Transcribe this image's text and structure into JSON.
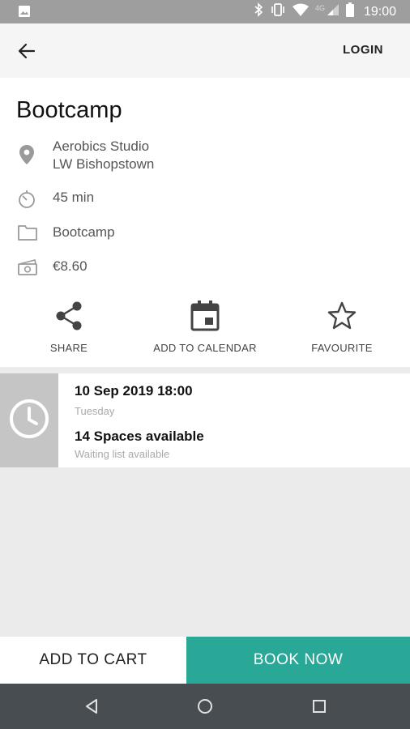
{
  "status_bar": {
    "time": "19:00",
    "network": "4G",
    "icons": [
      "image-icon",
      "bluetooth-icon",
      "vibrate-icon",
      "wifi-icon",
      "signal-icon",
      "battery-icon"
    ]
  },
  "toolbar": {
    "back_icon": "arrow-left-icon",
    "login_label": "LOGIN"
  },
  "class_detail": {
    "title": "Bootcamp",
    "location_line1": "Aerobics Studio",
    "location_line2": "LW Bishopstown",
    "duration": "45 min",
    "category": "Bootcamp",
    "price": "€8.60"
  },
  "actions": {
    "share_label": "SHARE",
    "calendar_label": "ADD TO CALENDAR",
    "favourite_label": "FAVOURITE"
  },
  "session": {
    "date_time": "10 Sep 2019 18:00",
    "day": "Tuesday",
    "spaces": "14 Spaces available",
    "waiting": "Waiting list available"
  },
  "bottom": {
    "add_to_cart": "ADD TO CART",
    "book_now": "BOOK NOW"
  },
  "colors": {
    "accent": "#29a898",
    "status_bar": "#9e9e9e",
    "nav_bar": "#474d50",
    "clock_block": "#c5c5c5"
  }
}
